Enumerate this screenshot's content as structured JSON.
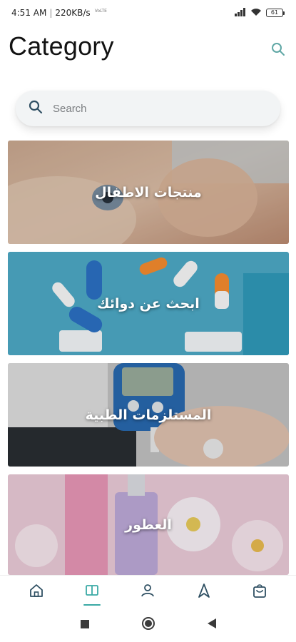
{
  "status_bar": {
    "time": "4:51 AM",
    "separator": "|",
    "network_speed": "220KB/s",
    "network_small": "VoLTE",
    "battery": "61"
  },
  "header": {
    "title": "Category"
  },
  "search": {
    "placeholder": "Search"
  },
  "categories": [
    {
      "label": "منتجات الاطفال"
    },
    {
      "label": "ابحث عن دوائك"
    },
    {
      "label": "المستلزمات الطبية"
    },
    {
      "label": "العطور"
    }
  ],
  "bottom_nav": {
    "active": "catalog",
    "items": [
      "home",
      "catalog",
      "profile",
      "navigate",
      "cart"
    ],
    "accent": "#3aa9a5"
  }
}
